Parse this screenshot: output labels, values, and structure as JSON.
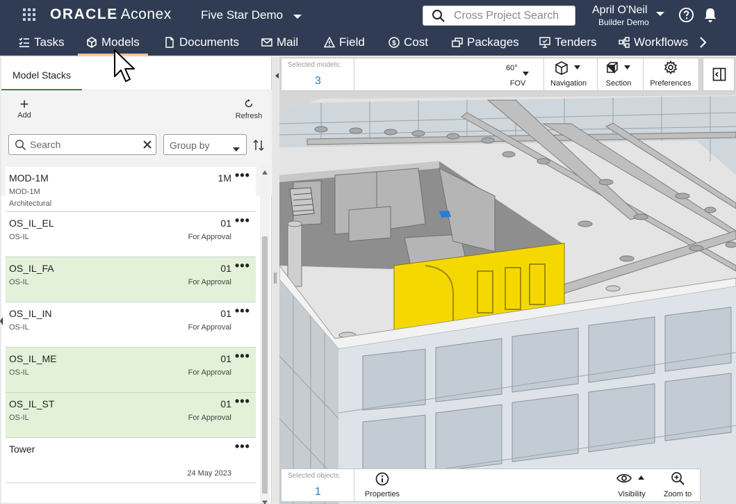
{
  "header": {
    "brand_oracle": "ORACLE",
    "brand_product": "Aconex",
    "project": "Five Star Demo",
    "search_placeholder": "Cross Project Search",
    "user_name": "April O'Neil",
    "user_org": "Builder Demo"
  },
  "nav": {
    "items": [
      {
        "label": "Tasks",
        "icon": "tasks-icon"
      },
      {
        "label": "Models",
        "icon": "cube-icon",
        "active": true
      },
      {
        "label": "Documents",
        "icon": "document-icon"
      },
      {
        "label": "Mail",
        "icon": "mail-icon"
      },
      {
        "label": "Field",
        "icon": "warning-icon"
      },
      {
        "label": "Cost",
        "icon": "dollar-icon"
      },
      {
        "label": "Packages",
        "icon": "packages-icon"
      },
      {
        "label": "Tenders",
        "icon": "tenders-icon"
      },
      {
        "label": "Workflows",
        "icon": "workflows-icon"
      }
    ]
  },
  "left_panel": {
    "tab": "Model Stacks",
    "add_label": "Add",
    "refresh_label": "Refresh",
    "search_placeholder": "Search",
    "group_by_placeholder": "Group by",
    "rows": [
      {
        "name": "MOD-1M",
        "rev": "1M",
        "sub": "MOD-1M",
        "sub2": "Architectural",
        "status": "",
        "date": "",
        "selected": false
      },
      {
        "name": "OS_IL_EL",
        "rev": "01",
        "sub": "OS-IL",
        "sub2": "",
        "status": "For Approval",
        "date": "",
        "selected": false
      },
      {
        "name": "OS_IL_FA",
        "rev": "01",
        "sub": "OS-IL",
        "sub2": "",
        "status": "For Approval",
        "date": "",
        "selected": true
      },
      {
        "name": "OS_IL_IN",
        "rev": "01",
        "sub": "OS-IL",
        "sub2": "",
        "status": "For Approval",
        "date": "",
        "selected": false
      },
      {
        "name": "OS_IL_ME",
        "rev": "01",
        "sub": "OS-IL",
        "sub2": "",
        "status": "For Approval",
        "date": "",
        "selected": true
      },
      {
        "name": "OS_IL_ST",
        "rev": "01",
        "sub": "OS-IL",
        "sub2": "",
        "status": "For Approval",
        "date": "",
        "selected": true
      },
      {
        "name": "Tower",
        "rev": "",
        "sub": "",
        "sub2": "",
        "status": "",
        "date": "24 May 2023",
        "selected": false
      }
    ]
  },
  "viewer": {
    "selected_models_label": "Selected models:",
    "selected_models_count": "3",
    "fov_value": "60°",
    "fov_label": "FOV",
    "navigation_label": "Navigation",
    "section_label": "Section",
    "preferences_label": "Preferences",
    "selected_objects_label": "Selected objects:",
    "selected_objects_count": "1",
    "properties_label": "Properties",
    "visibility_label": "Visibility",
    "zoom_label": "Zoom to"
  },
  "colors": {
    "header_bg": "#2f3c54",
    "active_tab_underline": "#f2c28c",
    "selected_row_bg": "#e3f1d9",
    "count_blue": "#2a7bbf",
    "highlight_yellow": "#f5d800"
  }
}
